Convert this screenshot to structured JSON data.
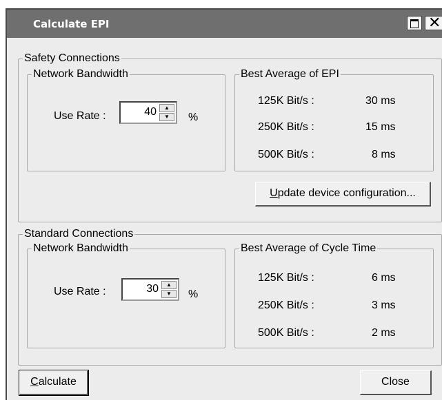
{
  "window": {
    "title": "Calculate EPI"
  },
  "safety": {
    "group_label": "Safety Connections",
    "bandwidth_label": "Network Bandwidth",
    "use_rate_label": "Use Rate :",
    "use_rate_value": "40",
    "percent": "%",
    "epi_label": "Best Average of EPI",
    "rows": [
      {
        "rate": "125K Bit/s :",
        "time": "30 ms"
      },
      {
        "rate": "250K Bit/s :",
        "time": "15 ms"
      },
      {
        "rate": "500K Bit/s :",
        "time": "8 ms"
      }
    ],
    "update_button": {
      "mnemonic": "U",
      "rest": "pdate device configuration..."
    }
  },
  "standard": {
    "group_label": "Standard Connections",
    "bandwidth_label": "Network Bandwidth",
    "use_rate_label": "Use Rate :",
    "use_rate_value": "30",
    "percent": "%",
    "cycle_label": "Best Average of Cycle Time",
    "rows": [
      {
        "rate": "125K Bit/s :",
        "time": "6 ms"
      },
      {
        "rate": "250K Bit/s :",
        "time": "3 ms"
      },
      {
        "rate": "500K Bit/s :",
        "time": "2 ms"
      }
    ]
  },
  "footer": {
    "calculate": {
      "mnemonic": "C",
      "rest": "alculate"
    },
    "close": "Close"
  }
}
